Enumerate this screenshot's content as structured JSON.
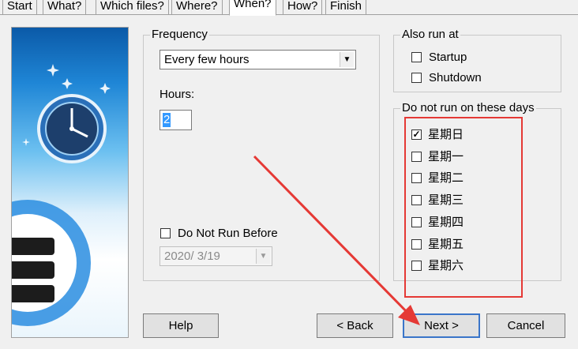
{
  "tabs": [
    "Start",
    "What?",
    "Which files?",
    "Where?",
    "When?",
    "How?",
    "Finish"
  ],
  "frequency": {
    "title": "Frequency",
    "value": "Every few hours"
  },
  "hours": {
    "label": "Hours:",
    "value": "2"
  },
  "do_not_run_before": {
    "label": "Do Not Run Before",
    "checked": false,
    "date": "2020/  3/19"
  },
  "also_run_at": {
    "title": "Also run at",
    "items": [
      {
        "label": "Startup",
        "checked": false
      },
      {
        "label": "Shutdown",
        "checked": false
      }
    ]
  },
  "days": {
    "title": "Do not run on these days",
    "items": [
      {
        "label": "星期日",
        "checked": true
      },
      {
        "label": "星期一",
        "checked": false
      },
      {
        "label": "星期二",
        "checked": false
      },
      {
        "label": "星期三",
        "checked": false
      },
      {
        "label": "星期四",
        "checked": false
      },
      {
        "label": "星期五",
        "checked": false
      },
      {
        "label": "星期六",
        "checked": false
      }
    ]
  },
  "buttons": {
    "help": "Help",
    "back": "< Back",
    "next": "Next >",
    "cancel": "Cancel"
  },
  "colors": {
    "annotation": "#e53935",
    "accent": "#3a75c9"
  }
}
